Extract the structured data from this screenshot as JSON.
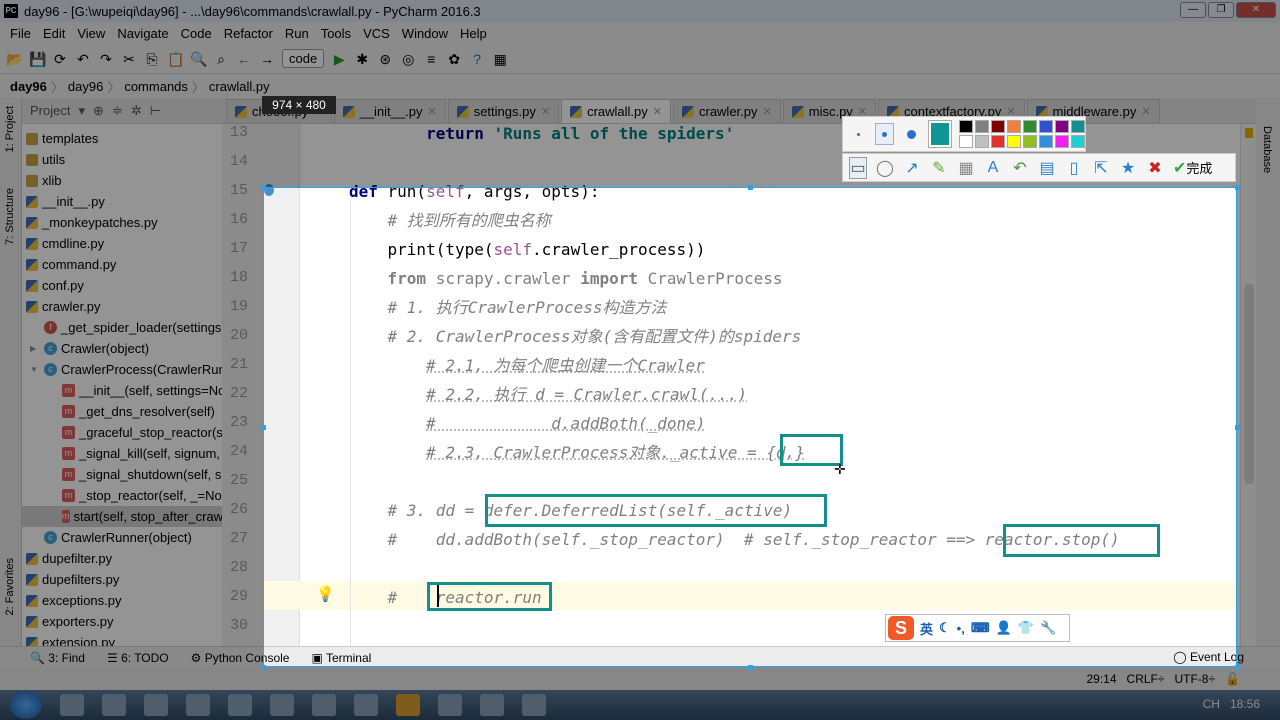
{
  "window": {
    "title": "day96 - [G:\\wupeiqi\\day96] - ...\\day96\\commands\\crawlall.py - PyCharm 2016.3",
    "controls": [
      "—",
      "❐",
      "✕"
    ]
  },
  "menu": [
    "File",
    "Edit",
    "View",
    "Navigate",
    "Code",
    "Refactor",
    "Run",
    "Tools",
    "VCS",
    "Window",
    "Help"
  ],
  "toolbar": {
    "run_config": "code",
    "icons": [
      "open-icon",
      "save-icon",
      "sync-icon",
      "undo-icon",
      "redo-icon",
      "cut-icon",
      "copy-icon",
      "paste-icon",
      "find-icon",
      "replace-icon",
      "back-icon",
      "forward-icon",
      "run-icon",
      "debug-icon",
      "coverage-icon",
      "profile-icon",
      "concurrency-icon",
      "settings-icon",
      "help-icon",
      "sdk-icon"
    ]
  },
  "breadcrumb": [
    "day96",
    "day96",
    "commands",
    "crawlall.py"
  ],
  "project": {
    "label": "Project",
    "side_labels": [
      "1: Project",
      "7: Structure",
      "2: Favorites"
    ]
  },
  "tooltip": "974 × 480",
  "tabs": [
    {
      "label": "chooof.py",
      "active": false
    },
    {
      "label": "__init__.py",
      "active": false
    },
    {
      "label": "settings.py",
      "active": false
    },
    {
      "label": "crawlall.py",
      "active": true
    },
    {
      "label": "crawler.py",
      "active": false
    },
    {
      "label": "misc.py",
      "active": false
    },
    {
      "label": "contextfactory.py",
      "active": false
    },
    {
      "label": "middleware.py",
      "active": false
    }
  ],
  "tree": [
    {
      "label": "templates",
      "icon": "folder",
      "indent": 0
    },
    {
      "label": "utils",
      "icon": "folder",
      "indent": 0
    },
    {
      "label": "xlib",
      "icon": "folder",
      "indent": 0
    },
    {
      "label": "__init__.py",
      "icon": "py",
      "indent": 0
    },
    {
      "label": "_monkeypatches.py",
      "icon": "py",
      "indent": 0
    },
    {
      "label": "cmdline.py",
      "icon": "py",
      "indent": 0
    },
    {
      "label": "command.py",
      "icon": "py",
      "indent": 0
    },
    {
      "label": "conf.py",
      "icon": "py",
      "indent": 0
    },
    {
      "label": "crawler.py",
      "icon": "py",
      "indent": 0
    },
    {
      "label": "_get_spider_loader(settings)",
      "icon": "f",
      "indent": 1
    },
    {
      "label": "Crawler(object)",
      "icon": "c",
      "indent": 1,
      "arrow": "▶"
    },
    {
      "label": "CrawlerProcess(CrawlerRunner)",
      "icon": "c",
      "indent": 1,
      "arrow": "▼"
    },
    {
      "label": "__init__(self, settings=None)",
      "icon": "m",
      "indent": 2
    },
    {
      "label": "_get_dns_resolver(self)",
      "icon": "m",
      "indent": 2
    },
    {
      "label": "_graceful_stop_reactor(self)",
      "icon": "m",
      "indent": 2
    },
    {
      "label": "_signal_kill(self, signum, _)",
      "icon": "m",
      "indent": 2
    },
    {
      "label": "_signal_shutdown(self, signum, _)",
      "icon": "m",
      "indent": 2
    },
    {
      "label": "_stop_reactor(self, _=None)",
      "icon": "m",
      "indent": 2
    },
    {
      "label": "start(self, stop_after_crawl=True)",
      "icon": "m",
      "indent": 2,
      "selected": true
    },
    {
      "label": "CrawlerRunner(object)",
      "icon": "c",
      "indent": 1
    },
    {
      "label": "dupefilter.py",
      "icon": "py",
      "indent": 0
    },
    {
      "label": "dupefilters.py",
      "icon": "py",
      "indent": 0
    },
    {
      "label": "exceptions.py",
      "icon": "py",
      "indent": 0
    },
    {
      "label": "exporters.py",
      "icon": "py",
      "indent": 0
    },
    {
      "label": "extension.py",
      "icon": "py",
      "indent": 0
    }
  ],
  "code": [
    {
      "n": "13",
      "segs": [
        [
          "        ",
          "plain"
        ],
        [
          "return ",
          "kw"
        ],
        [
          "'Runs all of the spiders'",
          "str"
        ]
      ]
    },
    {
      "n": "14",
      "segs": []
    },
    {
      "n": "15",
      "segs": [
        [
          "def ",
          "kw"
        ],
        [
          "run(",
          "plain"
        ],
        [
          "self",
          "self"
        ],
        [
          ", args, opts):",
          "plain"
        ]
      ]
    },
    {
      "n": "16",
      "segs": [
        [
          "    ",
          "plain"
        ],
        [
          "# 找到所有的爬虫名称",
          "cm"
        ]
      ]
    },
    {
      "n": "17",
      "segs": [
        [
          "    print(type(",
          "plain"
        ],
        [
          "self",
          "self"
        ],
        [
          ".crawler_process))",
          "plain"
        ]
      ]
    },
    {
      "n": "18",
      "segs": [
        [
          "    ",
          "plain"
        ],
        [
          "from ",
          "kw gray"
        ],
        [
          "scrapy.crawler ",
          "gray"
        ],
        [
          "import ",
          "kw gray"
        ],
        [
          "CrawlerProcess",
          "gray"
        ]
      ]
    },
    {
      "n": "19",
      "segs": [
        [
          "    ",
          "plain"
        ],
        [
          "# 1. 执行CrawlerProcess构造方法",
          "cm"
        ]
      ]
    },
    {
      "n": "20",
      "segs": [
        [
          "    ",
          "plain"
        ],
        [
          "# 2. CrawlerProcess对象(含有配置文件)的spiders",
          "cm"
        ]
      ]
    },
    {
      "n": "21",
      "segs": [
        [
          "        ",
          "plain"
        ],
        [
          "# 2.1, 为每个爬虫创建一个Crawler",
          "cm ul"
        ]
      ]
    },
    {
      "n": "22",
      "segs": [
        [
          "        ",
          "plain"
        ],
        [
          "# 2.2, 执行 d = Crawler.crawl(...)",
          "cm ul"
        ]
      ]
    },
    {
      "n": "23",
      "segs": [
        [
          "        ",
          "plain"
        ],
        [
          "#            d.addBoth(_done)",
          "cm ul"
        ]
      ]
    },
    {
      "n": "24",
      "segs": [
        [
          "        ",
          "plain"
        ],
        [
          "# 2.3, CrawlerProcess对象._active = {d,}",
          "cm ul"
        ]
      ]
    },
    {
      "n": "25",
      "segs": []
    },
    {
      "n": "26",
      "segs": [
        [
          "    ",
          "plain"
        ],
        [
          "# 3. dd = defer.DeferredList(self._active)",
          "cm"
        ]
      ]
    },
    {
      "n": "27",
      "segs": [
        [
          "    ",
          "plain"
        ],
        [
          "#    dd.addBoth(self._stop_reactor)  # self._stop_reactor ==> reactor.stop()",
          "cm"
        ]
      ]
    },
    {
      "n": "28",
      "segs": []
    },
    {
      "n": "29",
      "segs": [
        [
          "    ",
          "plain"
        ],
        [
          "#    reactor.run",
          "cm"
        ]
      ]
    },
    {
      "n": "30",
      "segs": []
    }
  ],
  "screenshot_tool": {
    "pen_sizes": [
      "small",
      "medium",
      "large"
    ],
    "current_color": "#0f9797",
    "palette": [
      "#000000",
      "#808080",
      "#800000",
      "#f08040",
      "#2e8b2e",
      "#3050d0",
      "#800080",
      "#109090",
      "#ffffff",
      "#c0c0c0",
      "#e03030",
      "#ffff00",
      "#90c020",
      "#3090e0",
      "#f020f0",
      "#20d0d0"
    ],
    "tools": [
      "rectangle-icon",
      "ellipse-icon",
      "arrow-icon",
      "brush-icon",
      "mosaic-icon",
      "text-icon",
      "undo-icon",
      "save-icon",
      "pin-icon",
      "share-icon",
      "favorite-icon",
      "cancel-icon"
    ],
    "done_label": "完成",
    "highlight_color": "#14908a"
  },
  "ime": {
    "logo": "S",
    "lang": "英",
    "icons": [
      "☾",
      "•,",
      "⌨",
      "👤",
      "👕",
      "🔧"
    ]
  },
  "bottom_tools": [
    "3: Find",
    "6: TODO",
    "Python Console",
    "Terminal"
  ],
  "event_log": "Event Log",
  "right_strip": "Database",
  "status": {
    "position": "29:14",
    "line_sep": "CRLF÷",
    "encoding": "UTF-8÷"
  },
  "taskbar": {
    "clock": "18:56",
    "lang": "CH"
  }
}
